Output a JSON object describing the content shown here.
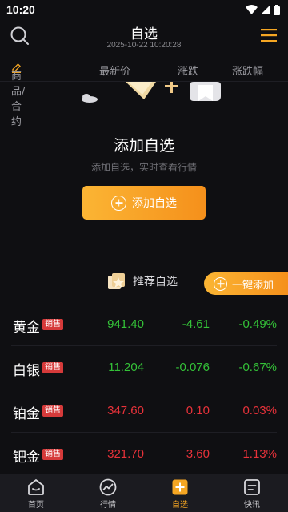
{
  "status_bar": {
    "time": "10:20"
  },
  "header": {
    "title": "自选",
    "datetime": "2025-10-22 10:20:28"
  },
  "columns": {
    "product": "商品/合约",
    "price": "最新价",
    "change": "涨跌",
    "pct": "涨跌幅"
  },
  "empty_state": {
    "title": "添加自选",
    "subtitle": "添加自选，实时查看行情",
    "add_button": "添加自选"
  },
  "recommend": {
    "label": "推荐自选",
    "one_click": "一键添加"
  },
  "quotes": [
    {
      "name": "黄金",
      "badge": "销售",
      "price": "941.40",
      "change": "-4.61",
      "pct": "-0.49%",
      "color": "#34c138"
    },
    {
      "name": "白银",
      "badge": "销售",
      "price": "11.204",
      "change": "-0.076",
      "pct": "-0.67%",
      "color": "#34c138"
    },
    {
      "name": "铂金",
      "badge": "销售",
      "price": "347.60",
      "change": "0.10",
      "pct": "0.03%",
      "color": "#e8323a"
    },
    {
      "name": "钯金",
      "badge": "销售",
      "price": "321.70",
      "change": "3.60",
      "pct": "1.13%",
      "color": "#e8323a"
    }
  ],
  "tabs": [
    {
      "label": "首页",
      "icon": "home-icon"
    },
    {
      "label": "行情",
      "icon": "trend-icon"
    },
    {
      "label": "自选",
      "icon": "favorites-icon",
      "active": true
    },
    {
      "label": "快讯",
      "icon": "news-icon"
    }
  ],
  "colors": {
    "accent": "#f5a623",
    "up": "#e8323a",
    "down": "#34c138",
    "background": "#0f0f12"
  }
}
